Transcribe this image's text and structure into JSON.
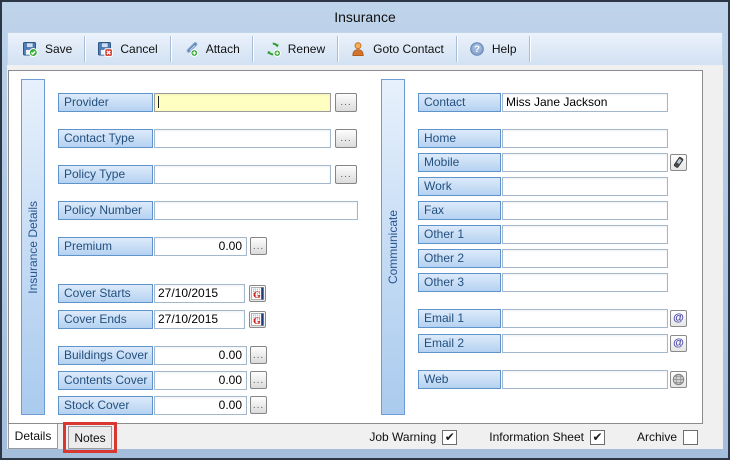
{
  "window": {
    "title": "Insurance"
  },
  "toolbar": {
    "save": "Save",
    "cancel": "Cancel",
    "attach": "Attach",
    "renew": "Renew",
    "goto_contact": "Goto Contact",
    "help": "Help"
  },
  "details_panel": {
    "title": "Insurance Details",
    "fields": [
      {
        "label": "Provider",
        "value": ""
      },
      {
        "label": "Contact Type",
        "value": ""
      },
      {
        "label": "Policy Type",
        "value": ""
      },
      {
        "label": "Policy Number",
        "value": ""
      },
      {
        "label": "Premium",
        "value": "0.00"
      },
      {
        "label": "Cover Starts",
        "value": "27/10/2015"
      },
      {
        "label": "Cover Ends",
        "value": "27/10/2015"
      },
      {
        "label": "Buildings Cover",
        "value": "0.00"
      },
      {
        "label": "Contents Cover",
        "value": "0.00"
      },
      {
        "label": "Stock Cover",
        "value": "0.00"
      }
    ]
  },
  "communicate_panel": {
    "title": "Communicate",
    "fields": [
      {
        "label": "Contact",
        "value": "Miss Jane Jackson"
      },
      {
        "label": "Home",
        "value": ""
      },
      {
        "label": "Mobile",
        "value": ""
      },
      {
        "label": "Work",
        "value": ""
      },
      {
        "label": "Fax",
        "value": ""
      },
      {
        "label": "Other 1",
        "value": ""
      },
      {
        "label": "Other 2",
        "value": ""
      },
      {
        "label": "Other 3",
        "value": ""
      },
      {
        "label": "Email 1",
        "value": ""
      },
      {
        "label": "Email 2",
        "value": ""
      },
      {
        "label": "Web",
        "value": ""
      }
    ]
  },
  "tabs": {
    "details": "Details",
    "notes": "Notes"
  },
  "footer": {
    "checkboxes": [
      {
        "label": "Job Warning",
        "checked": true,
        "mark": "✔"
      },
      {
        "label": "Information Sheet",
        "checked": true,
        "mark": "✔"
      },
      {
        "label": "Archive",
        "checked": false,
        "mark": ""
      }
    ]
  },
  "ui": {
    "browse_label": "...",
    "at_glyph": "@"
  },
  "colors": {
    "label_border": "#5f93cc",
    "field_yellow": "#ffffc2",
    "annotation_red": "#d93831",
    "chrome_blue": "#afc8e3"
  }
}
